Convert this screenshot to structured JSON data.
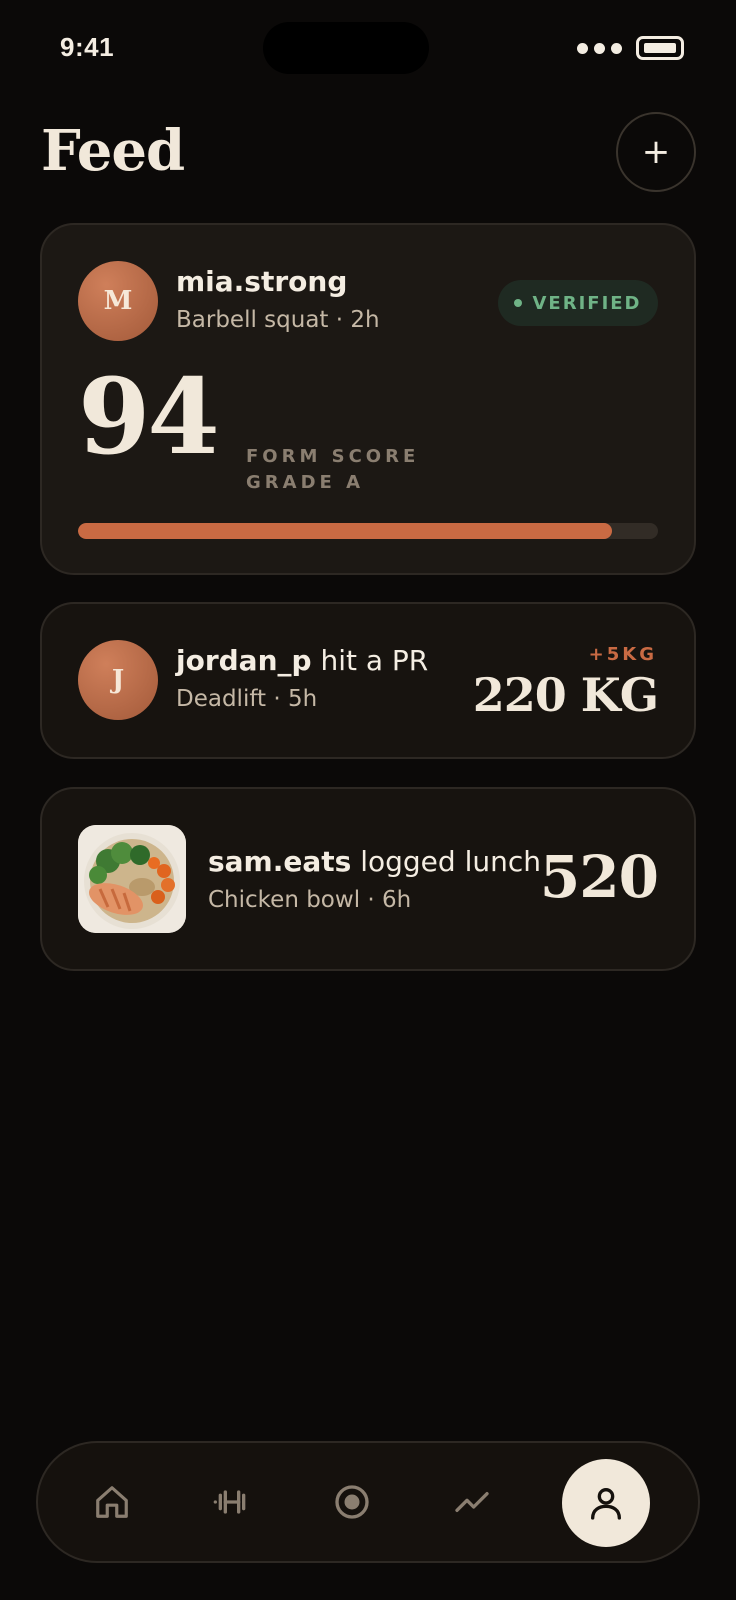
{
  "status_bar": {
    "time": "9:41"
  },
  "header": {
    "title": "Feed"
  },
  "posts": [
    {
      "initial": "M",
      "user": "mia.strong",
      "action": "",
      "subtitle": "Barbell squat · 2h",
      "badge": "VERIFIED",
      "score": "94",
      "score_label_1": "FORM SCORE",
      "score_label_2": "GRADE A",
      "progress_fraction": 0.92
    },
    {
      "initial": "J",
      "user": "jordan_p",
      "action": " hit a PR",
      "subtitle": "Deadlift · 5h",
      "delta": "+5KG",
      "value": "220 KG"
    },
    {
      "user": "sam.eats",
      "action": " logged lunch",
      "subtitle": "Chicken bowl · 6h",
      "value": "520",
      "thumb_icon": "food-bowl"
    }
  ],
  "nav": {
    "items": [
      "home-icon",
      "dumbbell-icon",
      "record-icon",
      "trend-icon",
      "profile-icon"
    ],
    "active": "profile-icon"
  },
  "colors": {
    "accent": "#c96a43",
    "verified": "#6fb386",
    "background": "#0b0908",
    "card": "#17130f",
    "cream": "#f1e8da"
  }
}
